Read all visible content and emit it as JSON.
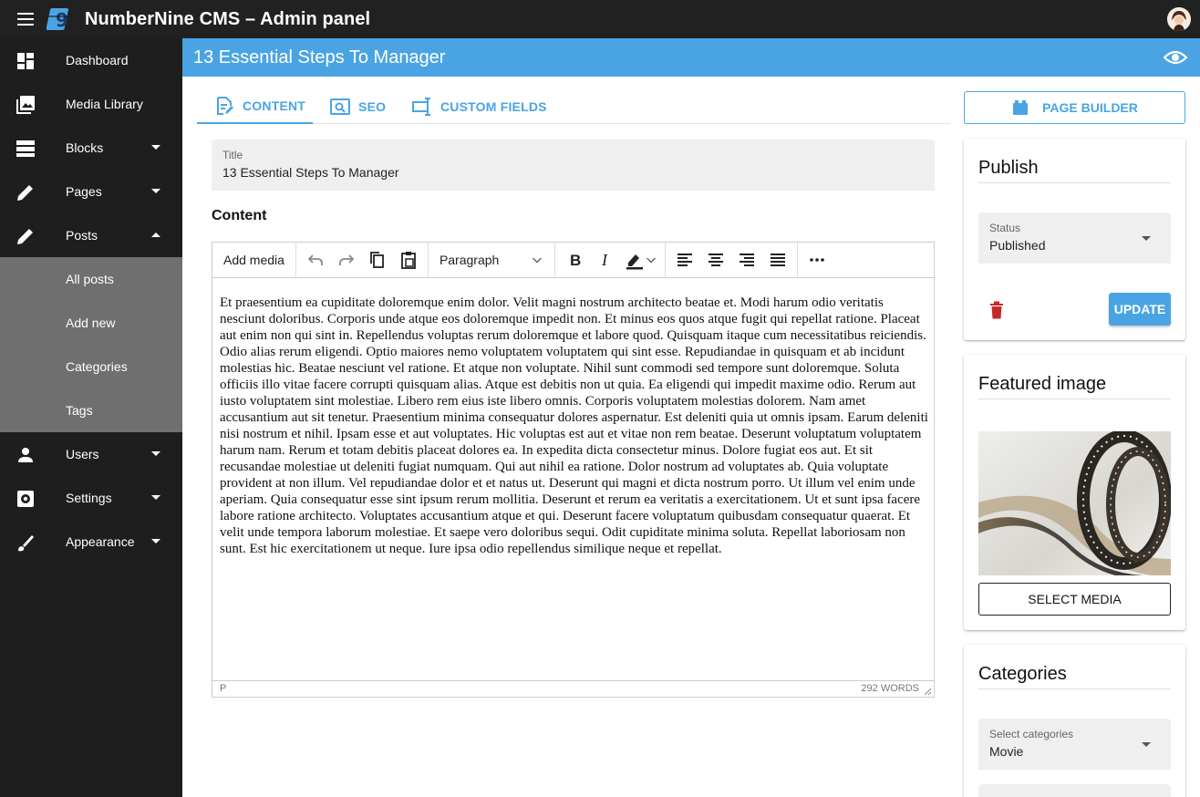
{
  "app": {
    "title": "NumberNine CMS – Admin panel"
  },
  "sidebar": {
    "items": [
      {
        "label": "Dashboard"
      },
      {
        "label": "Media Library"
      },
      {
        "label": "Blocks"
      },
      {
        "label": "Pages"
      },
      {
        "label": "Posts"
      },
      {
        "label": "Users"
      },
      {
        "label": "Settings"
      },
      {
        "label": "Appearance"
      }
    ],
    "posts_sub": [
      {
        "label": "All posts"
      },
      {
        "label": "Add new"
      },
      {
        "label": "Categories"
      },
      {
        "label": "Tags"
      }
    ]
  },
  "header": {
    "page_title": "13 Essential Steps To Manager"
  },
  "tabs": [
    {
      "label": "CONTENT",
      "active": true
    },
    {
      "label": "SEO",
      "active": false
    },
    {
      "label": "CUSTOM FIELDS",
      "active": false
    }
  ],
  "title_field": {
    "label": "Title",
    "value": "13 Essential Steps To Manager"
  },
  "content_heading": "Content",
  "editor": {
    "add_media_label": "Add media",
    "block_format": "Paragraph",
    "body": "Et praesentium ea cupiditate doloremque enim dolor. Velit magni nostrum architecto beatae et. Modi harum odio veritatis nesciunt doloribus. Corporis unde atque eos doloremque impedit non. Et minus eos quos atque fugit qui repellat ratione. Placeat aut enim non qui sint in. Repellendus voluptas rerum doloremque et labore quod. Quisquam itaque cum necessitatibus reiciendis. Odio alias rerum eligendi. Optio maiores nemo voluptatem voluptatem qui sint esse. Repudiandae in quisquam et ab incidunt molestias hic. Beatae nesciunt vel ratione. Et atque non voluptate. Nihil sunt commodi sed tempore sunt doloremque. Soluta officiis illo vitae facere corrupti quisquam alias. Atque est debitis non ut quia. Ea eligendi qui impedit maxime odio. Rerum aut iusto voluptatem sint molestiae. Libero rem eius iste libero omnis. Corporis voluptatem molestias dolorem. Nam amet accusantium aut sit tenetur. Praesentium minima consequatur dolores aspernatur. Est deleniti quia ut omnis ipsam. Earum deleniti nisi nostrum et nihil. Ipsam esse et aut voluptates. Hic voluptas est aut et vitae non rem beatae. Deserunt voluptatum voluptatem harum nam. Rerum et totam debitis placeat dolores ea. In expedita dicta consectetur minus. Dolore fugiat eos aut. Et sit recusandae molestiae ut deleniti fugiat numquam. Qui aut nihil ea ratione. Dolor nostrum ad voluptates ab. Quia voluptate provident at non illum. Vel repudiandae dolor et et natus ut. Deserunt qui magni et dicta nostrum porro. Ut illum vel enim unde aperiam. Quia consequatur esse sint ipsum rerum mollitia. Deserunt et rerum ea veritatis a exercitationem. Ut et sunt ipsa facere labore ratione architecto. Voluptates accusantium atque et qui. Deserunt facere voluptatum quibusdam consequatur quaerat. Et velit unde tempora laborum molestiae. Et saepe vero doloribus sequi. Odit cupiditate minima soluta. Repellat laboriosam non sunt. Est hic exercitationem ut neque. Iure ipsa odio repellendus similique neque et repellat.",
    "status_path": "P",
    "word_count": "292 WORDS"
  },
  "page_builder": {
    "label": "PAGE BUILDER"
  },
  "publish": {
    "title": "Publish",
    "status_label": "Status",
    "status_value": "Published",
    "update_label": "UPDATE"
  },
  "featured_image": {
    "title": "Featured image",
    "select_label": "SELECT MEDIA"
  },
  "categories": {
    "title": "Categories",
    "select_label": "Select categories",
    "select_value": "Movie"
  },
  "colors": {
    "accent": "#4aa4e4",
    "appbar": "#212121",
    "sidebar": "#1e1e1e",
    "subnav": "#6f6f6f",
    "danger": "#c62828"
  }
}
